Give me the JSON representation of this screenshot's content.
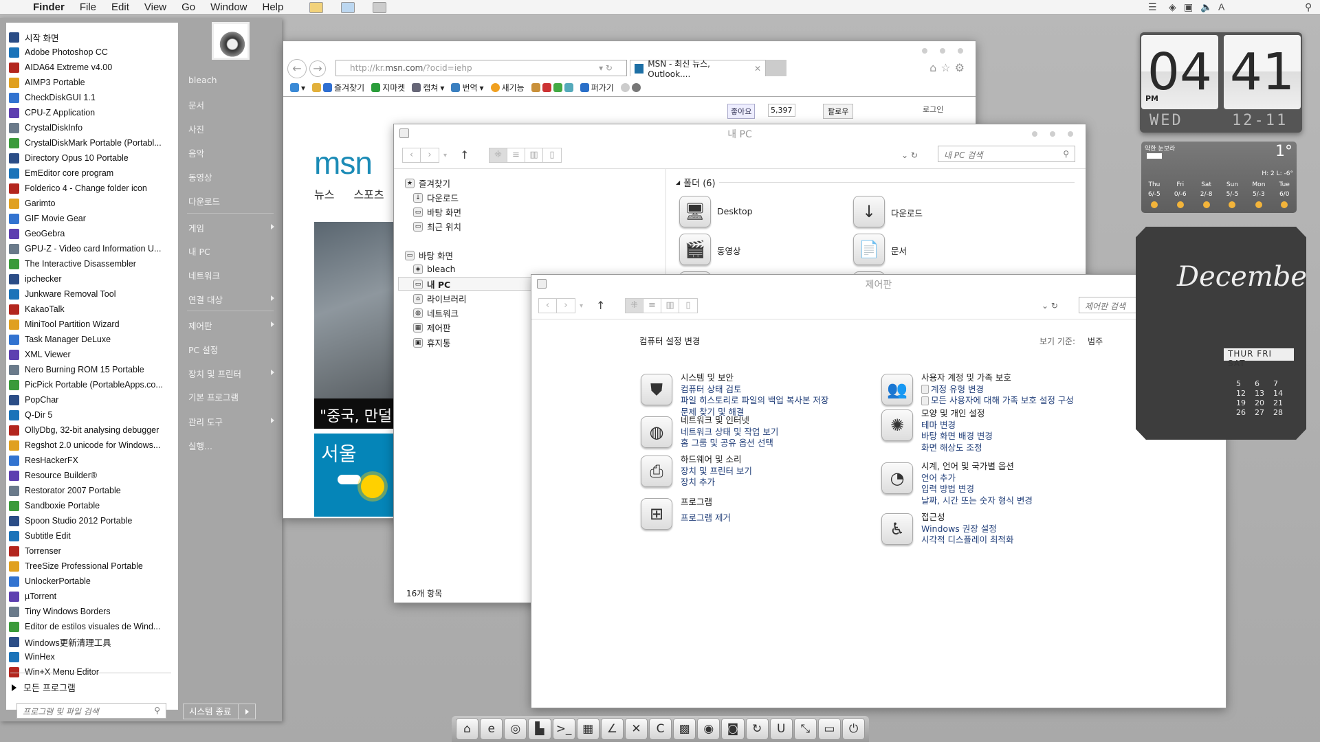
{
  "menubar": {
    "app": "Finder",
    "items": [
      "File",
      "Edit",
      "View",
      "Go",
      "Window",
      "Help"
    ]
  },
  "start_menu": {
    "apps": [
      "시작 화면",
      "Adobe Photoshop CC",
      "AIDA64 Extreme v4.00",
      "AIMP3 Portable",
      "CheckDiskGUI 1.1",
      "CPU-Z Application",
      "CrystalDiskInfo",
      "CrystalDiskMark Portable (Portabl...",
      "Directory Opus 10 Portable",
      "EmEditor core program",
      "Folderico 4 - Change folder icon",
      "Garimto",
      "GIF Movie Gear",
      "GeoGebra",
      "GPU-Z - Video card Information U...",
      "The Interactive Disassembler",
      "ipchecker",
      "Junkware Removal Tool",
      "KakaoTalk",
      "MiniTool Partition Wizard",
      "Task Manager DeLuxe",
      "XML Viewer",
      "Nero Burning ROM 15 Portable",
      "PicPick Portable (PortableApps.co...",
      "PopChar",
      "Q-Dir 5",
      "OllyDbg, 32-bit analysing debugger",
      "Regshot 2.0 unicode for Windows...",
      "ResHackerFX",
      "Resource Builder®",
      "Restorator 2007 Portable",
      "Sandboxie Portable",
      "Spoon Studio 2012 Portable",
      "Subtitle Edit",
      "Torrenser",
      "TreeSize Professional Portable",
      "UnlockerPortable",
      "µTorrent",
      "Tiny Windows Borders",
      "Editor de estilos visuales de Wind...",
      "Windows更新清理工具",
      "WinHex",
      "Win+X Menu Editor"
    ],
    "all_programs": "모든 프로그램",
    "search_placeholder": "프로그램 및 파일 검색",
    "right_items": [
      {
        "label": "bleach"
      },
      {
        "label": "문서"
      },
      {
        "label": "사진"
      },
      {
        "label": "음악"
      },
      {
        "label": "동영상"
      },
      {
        "label": "다운로드"
      },
      {
        "label": "게임",
        "sub": true
      },
      {
        "label": "내 PC"
      },
      {
        "label": "네트워크"
      },
      {
        "label": "연결 대상",
        "sub": true
      },
      {
        "label": "제어판",
        "sub": true
      },
      {
        "label": "PC 설정"
      },
      {
        "label": "장치 및 프린터",
        "sub": true
      },
      {
        "label": "기본 프로그램"
      },
      {
        "label": "관리 도구",
        "sub": true
      },
      {
        "label": "실행..."
      }
    ],
    "shutdown": "시스템 종료"
  },
  "browser": {
    "url_prefix": "http://kr.",
    "url_domain": "msn.com",
    "url_suffix": "/?ocid=iehp",
    "tab_title": "MSN - 최신 뉴스, Outlook....",
    "toolbar": [
      "즐겨찾기",
      "지마켓",
      "캡쳐",
      "번역",
      "새기능",
      "퍼가기"
    ],
    "like": "좋아요",
    "like_count": "5,397",
    "follow": "팔로우",
    "login": "로그인",
    "logo": "msn",
    "nav": [
      "뉴스",
      "스포츠"
    ],
    "headline": "\"중국, 만덜",
    "weather_city": "서울"
  },
  "explorer": {
    "title": "내 PC",
    "search_placeholder": "내 PC 검색",
    "tree": [
      {
        "label": "즐겨찾기",
        "level": 0,
        "icon": "★"
      },
      {
        "label": "다운로드",
        "level": 1,
        "icon": "↓"
      },
      {
        "label": "바탕 화면",
        "level": 1,
        "icon": "▭"
      },
      {
        "label": "최근 위치",
        "level": 1,
        "icon": "▭"
      },
      {
        "label": "바탕 화면",
        "level": 0,
        "icon": "▭"
      },
      {
        "label": "bleach",
        "level": 1,
        "icon": "◈"
      },
      {
        "label": "내 PC",
        "level": 1,
        "icon": "▭",
        "selected": true
      },
      {
        "label": "라이브러리",
        "level": 1,
        "icon": "⌂"
      },
      {
        "label": "네트워크",
        "level": 1,
        "icon": "◍"
      },
      {
        "label": "제어판",
        "level": 1,
        "icon": "▦"
      },
      {
        "label": "휴지통",
        "level": 1,
        "icon": "▣"
      }
    ],
    "folders_header": "폴더 (6)",
    "folders": [
      {
        "label": "Desktop",
        "icon": "🖥"
      },
      {
        "label": "다운로드",
        "icon": "↓"
      },
      {
        "label": "동영상",
        "icon": "🎬"
      },
      {
        "label": "문서",
        "icon": "📄"
      }
    ],
    "status": "16개 항목"
  },
  "control_panel": {
    "title": "제어판",
    "search_placeholder": "제어판 검색",
    "heading": "컴퓨터 설정 변경",
    "view_by_label": "보기 기준:",
    "view_by_value": "범주",
    "left": [
      {
        "title": "시스템 및 보안",
        "icon": "shield",
        "links": [
          "컴퓨터 상태 검토",
          "파일 히스토리로 파일의 백업 복사본 저장",
          "문제 찾기 및 해결"
        ]
      },
      {
        "title": "네트워크 및 인터넷",
        "icon": "globe",
        "links": [
          "네트워크 상태 및 작업 보기",
          "홈 그룹 및 공유 옵션 선택"
        ]
      },
      {
        "title": "하드웨어 및 소리",
        "icon": "printer",
        "links": [
          "장치 및 프린터 보기",
          "장치 추가"
        ]
      },
      {
        "title": "프로그램",
        "icon": "windows",
        "links": [
          "프로그램 제거"
        ]
      }
    ],
    "right": [
      {
        "title": "사용자 계정 및 가족 보호",
        "icon": "users",
        "links": [
          "계정 유형 변경",
          "모든 사용자에 대해 가족 보호 설정 구성"
        ],
        "shield_links": true
      },
      {
        "title": "모양 및 개인 설정",
        "icon": "flower",
        "links": [
          "테마 변경",
          "바탕 화면 배경 변경",
          "화면 해상도 조정"
        ]
      },
      {
        "title": "시계, 언어 및 국가별 옵션",
        "icon": "clock",
        "links": [
          "언어 추가",
          "입력 방법 변경",
          "날짜, 시간 또는 숫자 형식 변경"
        ]
      },
      {
        "title": "접근성",
        "icon": "accessibility",
        "links": [
          "Windows 권장 설정",
          "시각적 디스플레이 최적화"
        ]
      }
    ]
  },
  "clock": {
    "hour": "04",
    "minute": "41",
    "ampm": "PM",
    "day": "WED",
    "date": "12-11"
  },
  "weather": {
    "location": "약한 눈보라",
    "temp": "1°",
    "hilo": "H: 2 L: -6°",
    "days": [
      {
        "d": "Thu",
        "t": "6/-5"
      },
      {
        "d": "Fri",
        "t": "0/-6"
      },
      {
        "d": "Sat",
        "t": "2/-8"
      },
      {
        "d": "Sun",
        "t": "5/-5"
      },
      {
        "d": "Mon",
        "t": "5/-3"
      },
      {
        "d": "Tue",
        "t": "6/0"
      }
    ]
  },
  "calendar": {
    "month": "December",
    "weekdays": "THUR FRI SAT",
    "numbers": [
      "5",
      "6",
      "7",
      "12",
      "13",
      "14",
      "19",
      "20",
      "21",
      "26",
      "27",
      "28"
    ]
  },
  "dock": [
    "home",
    "ie",
    "chrome",
    "finder",
    "terminal",
    "launchpad",
    "pen",
    "tools",
    "ccleaner",
    "control-panel",
    "game",
    "camera",
    "sync",
    "magnet",
    "resize",
    "window",
    "power"
  ]
}
